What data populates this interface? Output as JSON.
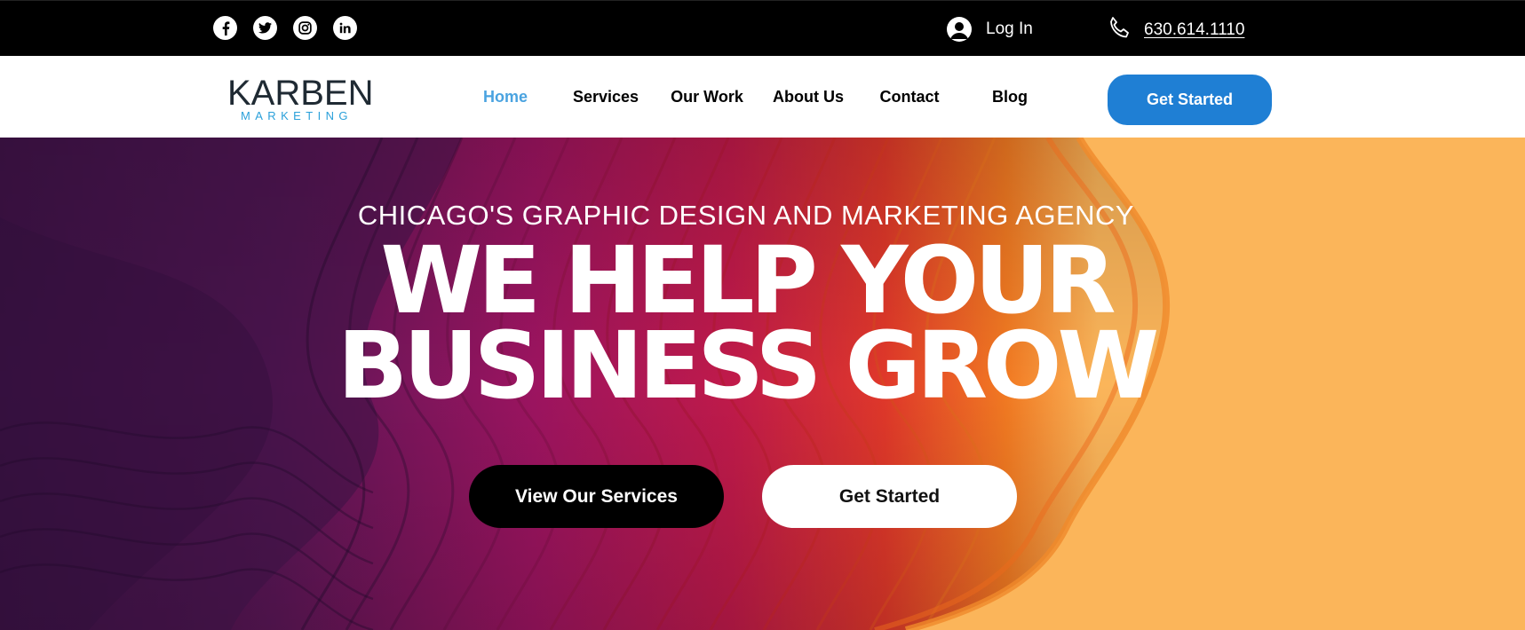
{
  "topbar": {
    "social": [
      {
        "name": "facebook-icon"
      },
      {
        "name": "twitter-icon"
      },
      {
        "name": "instagram-icon"
      },
      {
        "name": "linkedin-icon"
      }
    ],
    "login_label": "Log In",
    "phone": "630.614.1110"
  },
  "nav": {
    "logo_text": "KARBEN",
    "logo_sub": "MARKETING",
    "items": [
      {
        "label": "Home",
        "active": true
      },
      {
        "label": "Services"
      },
      {
        "label": "Our Work"
      },
      {
        "label": "About Us"
      },
      {
        "label": "Contact"
      },
      {
        "label": "Blog"
      }
    ],
    "cta": "Get Started"
  },
  "hero": {
    "subtitle": "CHICAGO'S GRAPHIC DESIGN AND MARKETING AGENCY",
    "title_line1": "WE HELP YOUR",
    "title_line2": "BUSINESS GROW",
    "primary_button": "View Our Services",
    "secondary_button": "Get Started"
  },
  "colors": {
    "accent_blue": "#1f7fd4",
    "active_nav": "#4aa3e0",
    "logo_blue": "#2aa0da",
    "hero_purple": "#4a1550",
    "hero_magenta": "#a0145a",
    "hero_red": "#d42a3c",
    "hero_orange": "#f28a2a",
    "hero_yellow": "#fbb55a"
  }
}
